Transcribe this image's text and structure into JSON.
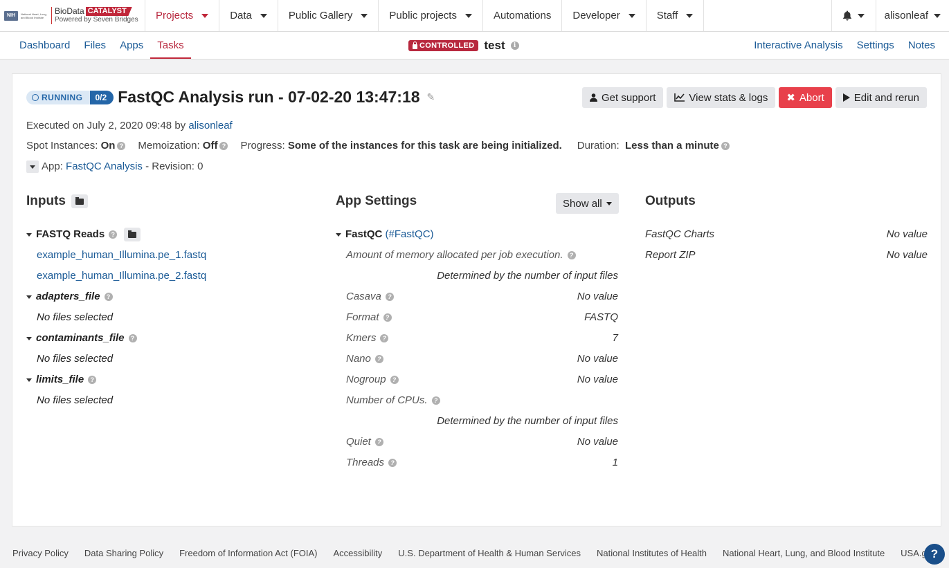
{
  "logo": {
    "nih": "NIH",
    "nih_text": "National Heart, Lung, and Blood Institute",
    "bio": "BioData",
    "catalyst": "CATALYST",
    "powered": "Powered by Seven Bridges"
  },
  "nav": {
    "items": [
      "Projects",
      "Data",
      "Public Gallery",
      "Public projects",
      "Automations",
      "Developer",
      "Staff"
    ],
    "active": "Projects",
    "user": "alisonleaf"
  },
  "subnav": {
    "tabs": [
      "Dashboard",
      "Files",
      "Apps",
      "Tasks"
    ],
    "active": "Tasks",
    "controlled_badge": "CONTROLLED",
    "project_name": "test",
    "right_links": [
      "Interactive Analysis",
      "Settings",
      "Notes"
    ]
  },
  "task": {
    "status": "RUNNING",
    "progress_count": "0/2",
    "title": "FastQC Analysis run - 07-02-20 13:47:18",
    "executed_prefix": "Executed on July 2, 2020 09:48 by",
    "executed_by": "alisonleaf",
    "spot_label": "Spot Instances:",
    "spot_value": "On",
    "memo_label": "Memoization:",
    "memo_value": "Off",
    "progress_label": "Progress:",
    "progress_value": "Some of the instances for this task are being initialized.",
    "duration_label": "Duration:",
    "duration_value": "Less than a minute",
    "app_label": "App:",
    "app_name": "FastQC Analysis",
    "app_revision": "- Revision: 0"
  },
  "actions": {
    "support": "Get support",
    "stats": "View stats & logs",
    "abort": "Abort",
    "rerun": "Edit and rerun"
  },
  "inputs": {
    "heading": "Inputs",
    "fastq_label": "FASTQ Reads",
    "fastq_files": [
      "example_human_Illumina.pe_1.fastq",
      "example_human_Illumina.pe_2.fastq"
    ],
    "adapters_label": "adapters_file",
    "contaminants_label": "contaminants_file",
    "limits_label": "limits_file",
    "no_files": "No files selected"
  },
  "settings": {
    "heading": "App Settings",
    "show_all": "Show all",
    "group": "FastQC",
    "group_ref": "(#FastQC)",
    "memory_label": "Amount of memory allocated per job execution.",
    "determined": "Determined by the number of input files",
    "casava": {
      "label": "Casava",
      "value": "No value"
    },
    "format": {
      "label": "Format",
      "value": "FASTQ"
    },
    "kmers": {
      "label": "Kmers",
      "value": "7"
    },
    "nano": {
      "label": "Nano",
      "value": "No value"
    },
    "nogroup": {
      "label": "Nogroup",
      "value": "No value"
    },
    "cpus_label": "Number of CPUs.",
    "quiet": {
      "label": "Quiet",
      "value": "No value"
    },
    "threads": {
      "label": "Threads",
      "value": "1"
    }
  },
  "outputs": {
    "heading": "Outputs",
    "charts": {
      "label": "FastQC Charts",
      "value": "No value"
    },
    "zip": {
      "label": "Report ZIP",
      "value": "No value"
    }
  },
  "footer": [
    "Privacy Policy",
    "Data Sharing Policy",
    "Freedom of Information Act (FOIA)",
    "Accessibility",
    "U.S. Department of Health & Human Services",
    "National Institutes of Health",
    "National Heart, Lung, and Blood Institute",
    "USA.gov"
  ],
  "colors": {
    "accent_red": "#c0273a",
    "link_blue": "#1a5a96",
    "running_blue": "#2466a8",
    "abort_red": "#e8404b"
  }
}
